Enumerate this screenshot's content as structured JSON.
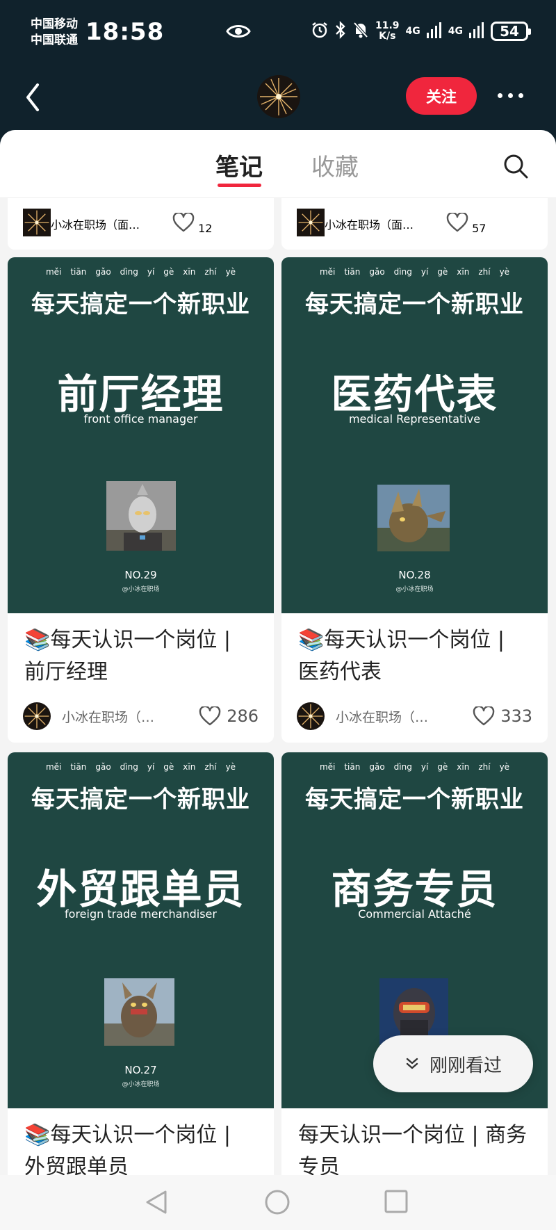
{
  "status_bar": {
    "carrier1": "中国移动",
    "carrier2": "中国联通",
    "time": "18:58",
    "speed_value": "11.9",
    "speed_unit": "K/s",
    "network1": "4G",
    "network2": "4G",
    "battery": "54"
  },
  "header": {
    "follow_label": "关注"
  },
  "tabs": {
    "notes": "笔记",
    "saved": "收藏"
  },
  "cover_template": {
    "pinyin": [
      "měi",
      "tiān",
      "gǎo",
      "dìng",
      "yí",
      "gè",
      "xīn",
      "zhí",
      "yè"
    ],
    "slogan": "每天搞定一个新职业",
    "handle": "@小冰在职场"
  },
  "top_row": [
    {
      "author": "小冰在职场（面…",
      "likes": "12"
    },
    {
      "author": "小冰在职场（面…",
      "likes": "57"
    }
  ],
  "cards": [
    {
      "job_cn": "前厅经理",
      "job_en": "front office manager",
      "no": "NO.29",
      "title": "📚每天认识一个岗位 | 前厅经理",
      "author": "小冰在职场（…",
      "likes": "286"
    },
    {
      "job_cn": "医药代表",
      "job_en": "medical Representative",
      "no": "NO.28",
      "title": "📚每天认识一个岗位 | 医药代表",
      "author": "小冰在职场（…",
      "likes": "333"
    },
    {
      "job_cn": "外贸跟单员",
      "job_en": "foreign trade merchandiser",
      "no": "NO.27",
      "title": "📚每天认识一个岗位 | 外贸跟单员",
      "author": "",
      "likes": ""
    },
    {
      "job_cn": "商务专员",
      "job_en": "Commercial Attaché",
      "no": "",
      "title": "每天认识一个岗位 | 商务专员",
      "author": "",
      "likes": ""
    }
  ],
  "recent_label": "刚刚看过",
  "colors": {
    "accent": "#f0263d",
    "cover_bg": "#1f4742",
    "header_bg": "#10222c"
  }
}
